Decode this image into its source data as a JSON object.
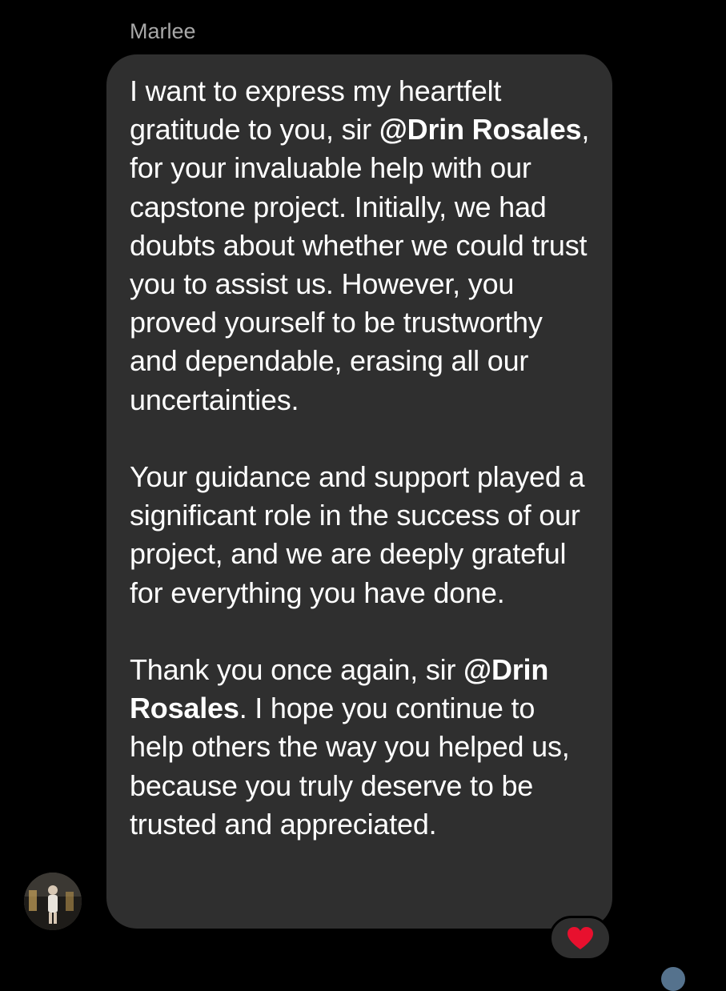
{
  "conversation": {
    "sender_name": "Marlee",
    "message": {
      "p1": {
        "t1": "I want to express my heartfelt gratitude to you, sir ",
        "mention": "@Drin Rosales",
        "t2": ", for your invaluable help with our capstone project. Initially, we had doubts about whether we could trust you to assist us. However, you proved yourself to be trustworthy and dependable, erasing all our uncertainties."
      },
      "p2": "Your guidance and support played a significant role in the success of our project, and we are deeply grateful for everything you have done.",
      "p3": {
        "t1": "Thank you once again, sir ",
        "mention": "@Drin Rosales",
        "t2": ". I hope you continue to help others the way you helped us, because you truly deserve to be trusted and appreciated."
      }
    },
    "reaction": {
      "icon": "heart-icon",
      "color": "#e8102e"
    }
  },
  "theme": {
    "background": "#000000",
    "bubble": "#2f2f2f",
    "sender_name_color": "#a8a8a8"
  }
}
